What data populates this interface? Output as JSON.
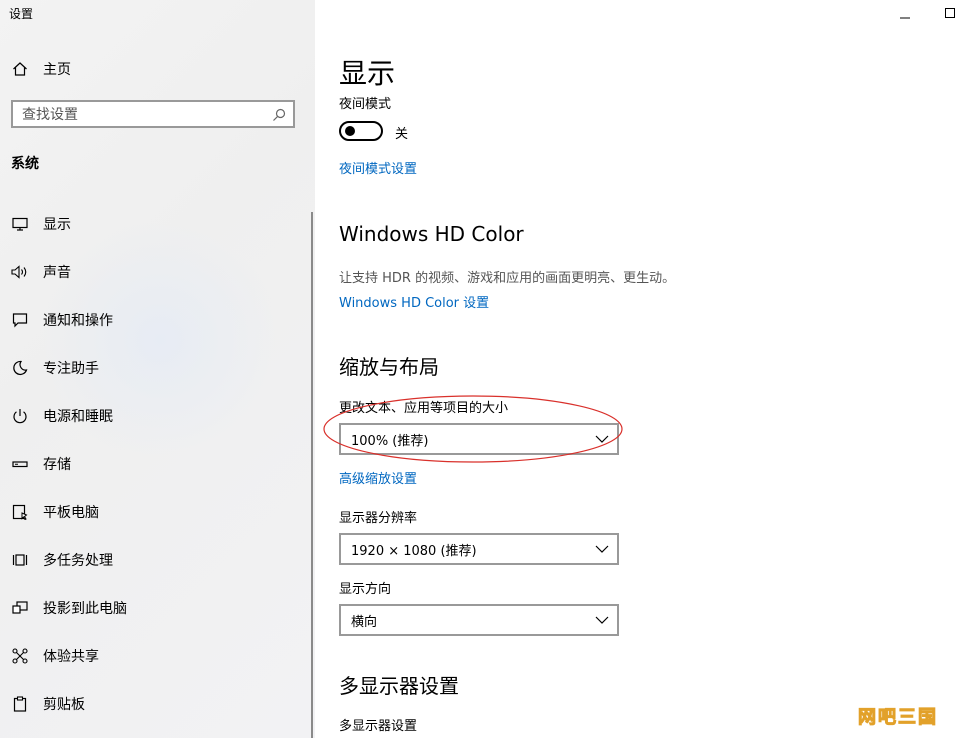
{
  "window": {
    "title": "设置"
  },
  "sidebar": {
    "home_label": "主页",
    "search_placeholder": "查找设置",
    "section_label": "系统",
    "items": [
      {
        "label": "显示",
        "icon": "monitor-icon"
      },
      {
        "label": "声音",
        "icon": "speaker-icon"
      },
      {
        "label": "通知和操作",
        "icon": "message-icon"
      },
      {
        "label": "专注助手",
        "icon": "moon-icon"
      },
      {
        "label": "电源和睡眠",
        "icon": "power-icon"
      },
      {
        "label": "存储",
        "icon": "storage-icon"
      },
      {
        "label": "平板电脑",
        "icon": "tablet-icon"
      },
      {
        "label": "多任务处理",
        "icon": "multitask-icon"
      },
      {
        "label": "投影到此电脑",
        "icon": "project-icon"
      },
      {
        "label": "体验共享",
        "icon": "share-icon"
      },
      {
        "label": "剪贴板",
        "icon": "clipboard-icon"
      }
    ]
  },
  "main": {
    "title": "显示",
    "night_mode": {
      "label": "夜间模式",
      "state_label": "关",
      "on": false,
      "settings_link": "夜间模式设置"
    },
    "hd_color": {
      "heading": "Windows HD Color",
      "description": "让支持 HDR 的视频、游戏和应用的画面更明亮、更生动。",
      "link": "Windows HD Color 设置"
    },
    "scale_layout": {
      "heading": "缩放与布局",
      "scale_label": "更改文本、应用等项目的大小",
      "scale_value": "100% (推荐)",
      "advanced_link": "高级缩放设置",
      "resolution_label": "显示器分辨率",
      "resolution_value": "1920 × 1080 (推荐)",
      "orientation_label": "显示方向",
      "orientation_value": "横向"
    },
    "multi_display": {
      "heading": "多显示器设置",
      "label": "多显示器设置"
    }
  },
  "colors": {
    "link": "#0067c0",
    "annotation": "#d9302b",
    "sidebar_bg": "#f2f2f2"
  },
  "watermark": "网吧三国"
}
